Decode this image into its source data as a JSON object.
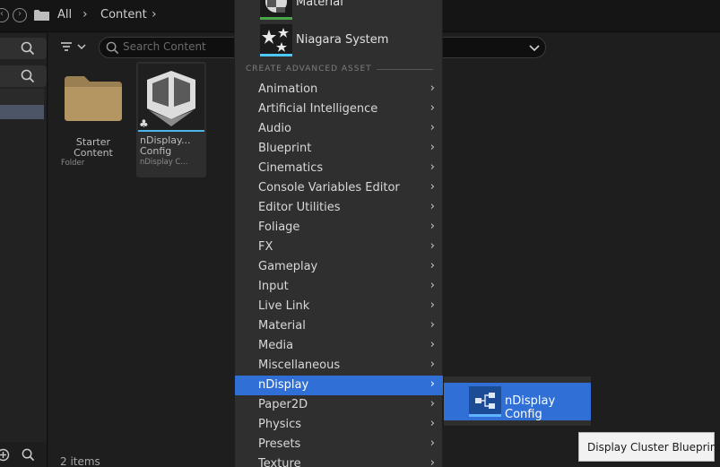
{
  "breadcrumb": {
    "items": [
      "All",
      "Content"
    ]
  },
  "search": {
    "placeholder": "Search Content"
  },
  "assets": [
    {
      "name_line1": "Starter",
      "name_line2": "Content",
      "type": "Folder"
    },
    {
      "name_line1": "nDisplay...",
      "name_line2": "Config",
      "type": "nDisplay C..."
    }
  ],
  "status": {
    "items_count": "2 items"
  },
  "menu": {
    "top_assets": [
      {
        "label": "Material",
        "icon": "material-icon",
        "accent": "#4aa64a"
      },
      {
        "label": "Niagara System",
        "icon": "niagara-icon",
        "accent": "#4dc8ff"
      }
    ],
    "section_title": "CREATE ADVANCED ASSET",
    "items": [
      {
        "label": "Animation"
      },
      {
        "label": "Artificial Intelligence"
      },
      {
        "label": "Audio"
      },
      {
        "label": "Blueprint"
      },
      {
        "label": "Cinematics"
      },
      {
        "label": "Console Variables Editor"
      },
      {
        "label": "Editor Utilities"
      },
      {
        "label": "Foliage"
      },
      {
        "label": "FX"
      },
      {
        "label": "Gameplay"
      },
      {
        "label": "Input"
      },
      {
        "label": "Live Link"
      },
      {
        "label": "Material"
      },
      {
        "label": "Media"
      },
      {
        "label": "Miscellaneous"
      },
      {
        "label": "nDisplay",
        "active": true
      },
      {
        "label": "Paper2D"
      },
      {
        "label": "Physics"
      },
      {
        "label": "Presets"
      },
      {
        "label": "Texture"
      }
    ]
  },
  "submenu": {
    "label": "nDisplay Config",
    "icon": "ndisplay-config-icon"
  },
  "tooltip": {
    "text": "Display Cluster Blueprint"
  },
  "colors": {
    "accent": "#2f6fd6",
    "menu_bg": "#2f2f2f",
    "panel_bg": "#1e1e1e"
  }
}
